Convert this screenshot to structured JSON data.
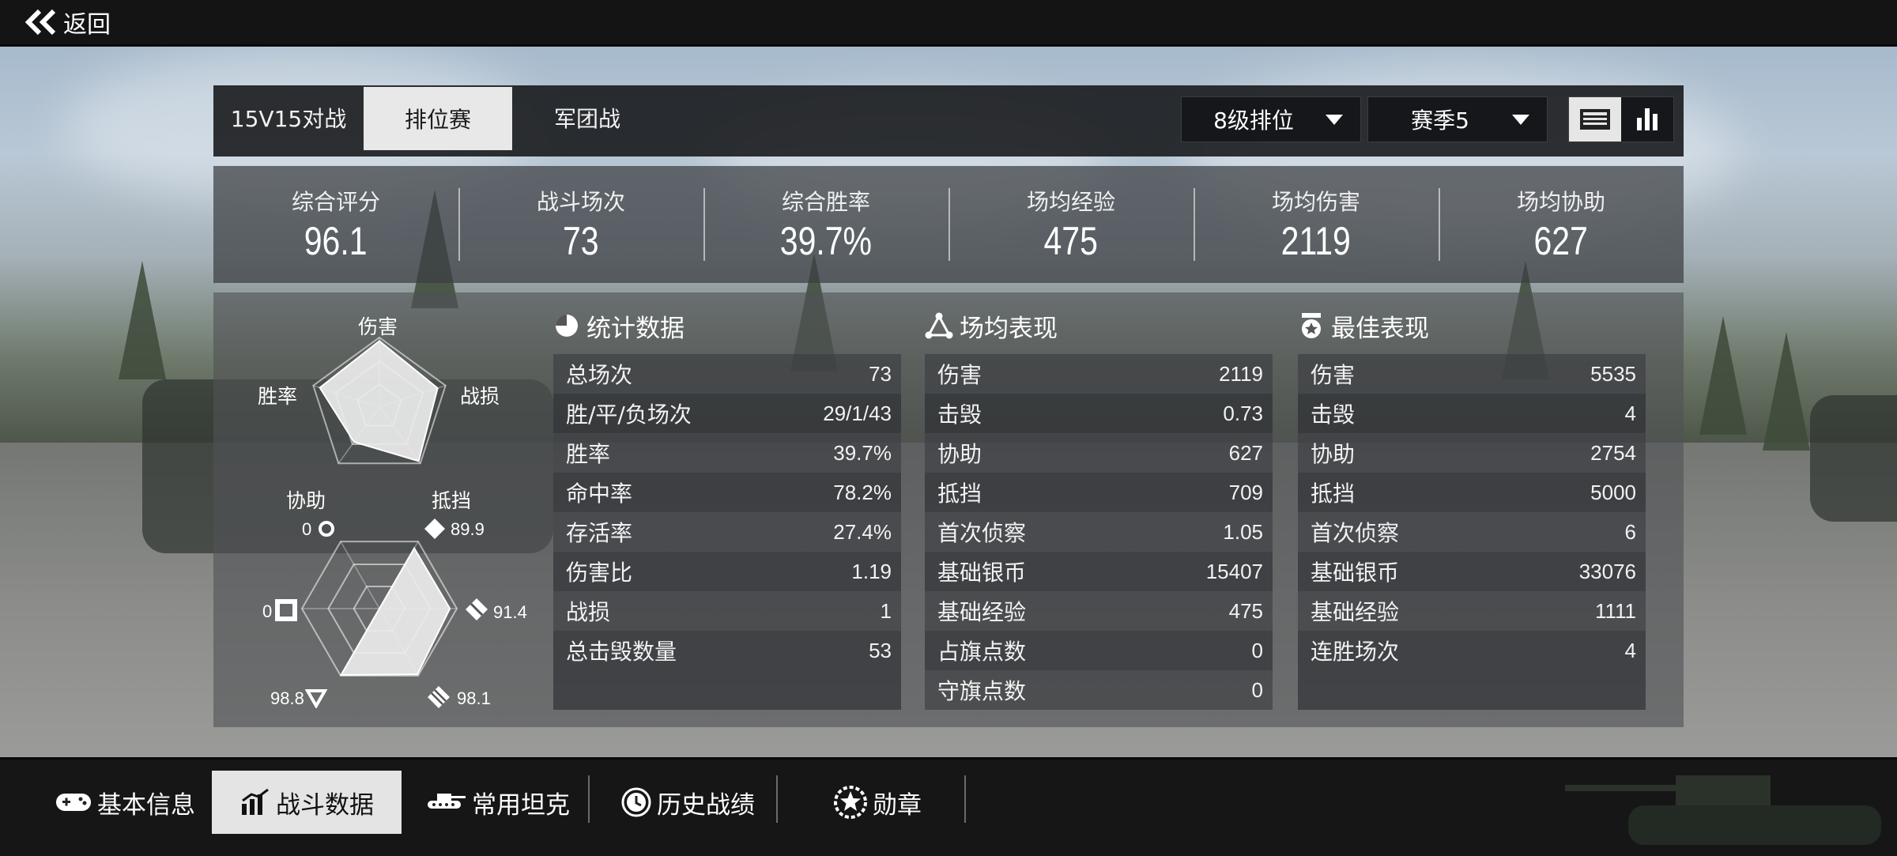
{
  "topbar": {
    "back_label": "返回"
  },
  "mode_tabs": [
    {
      "label": "15V15对战",
      "active": false
    },
    {
      "label": "排位赛",
      "active": true
    },
    {
      "label": "军团战",
      "active": false
    }
  ],
  "filters": {
    "tier": "8级排位",
    "season": "赛季5"
  },
  "view_toggle": {
    "active": "list"
  },
  "summary": [
    {
      "label": "综合评分",
      "value": "96.1"
    },
    {
      "label": "战斗场次",
      "value": "73"
    },
    {
      "label": "综合胜率",
      "value": "39.7%"
    },
    {
      "label": "场均经验",
      "value": "475"
    },
    {
      "label": "场均伤害",
      "value": "2119"
    },
    {
      "label": "场均协助",
      "value": "627"
    }
  ],
  "radar": {
    "labels": {
      "top": "伤害",
      "right": "战损",
      "left": "胜率",
      "bottom_left": "协助",
      "bottom_right": "抵挡"
    },
    "pentagon_levels": [
      0.95,
      0.88,
      0.96,
      0.62,
      0.9
    ],
    "hex_values": {
      "top_left": "0",
      "top_right": "89.9",
      "left": "0",
      "right": "91.4",
      "bottom_left": "98.8",
      "bottom_right": "98.1"
    },
    "hex_levels": [
      0.0,
      0.9,
      0.91,
      0.98,
      0.99,
      0.0
    ]
  },
  "stats": {
    "title": "统计数据",
    "rows": [
      {
        "k": "总场次",
        "v": "73"
      },
      {
        "k": "胜/平/负场次",
        "v": "29/1/43"
      },
      {
        "k": "胜率",
        "v": "39.7%"
      },
      {
        "k": "命中率",
        "v": "78.2%"
      },
      {
        "k": "存活率",
        "v": "27.4%"
      },
      {
        "k": "伤害比",
        "v": "1.19"
      },
      {
        "k": "战损",
        "v": "1"
      },
      {
        "k": "总击毁数量",
        "v": "53"
      }
    ]
  },
  "average": {
    "title": "场均表现",
    "rows": [
      {
        "k": "伤害",
        "v": "2119"
      },
      {
        "k": "击毁",
        "v": "0.73"
      },
      {
        "k": "协助",
        "v": "627"
      },
      {
        "k": "抵挡",
        "v": "709"
      },
      {
        "k": "首次侦察",
        "v": "1.05"
      },
      {
        "k": "基础银币",
        "v": "15407"
      },
      {
        "k": "基础经验",
        "v": "475"
      },
      {
        "k": "占旗点数",
        "v": "0"
      },
      {
        "k": "守旗点数",
        "v": "0"
      }
    ]
  },
  "best": {
    "title": "最佳表现",
    "rows": [
      {
        "k": "伤害",
        "v": "5535"
      },
      {
        "k": "击毁",
        "v": "4"
      },
      {
        "k": "协助",
        "v": "2754"
      },
      {
        "k": "抵挡",
        "v": "5000"
      },
      {
        "k": "首次侦察",
        "v": "6"
      },
      {
        "k": "基础银币",
        "v": "33076"
      },
      {
        "k": "基础经验",
        "v": "1111"
      },
      {
        "k": "连胜场次",
        "v": "4"
      }
    ]
  },
  "bottom_nav": [
    {
      "label": "基本信息",
      "icon": "gamepad-icon",
      "active": false
    },
    {
      "label": "战斗数据",
      "icon": "bar-chart-icon",
      "active": true
    },
    {
      "label": "常用坦克",
      "icon": "tank-icon",
      "active": false
    },
    {
      "label": "历史战绩",
      "icon": "history-clock-icon",
      "active": false
    },
    {
      "label": "勋章",
      "icon": "medal-icon",
      "active": false
    }
  ],
  "colors": {
    "accent": "#e8e8e8",
    "panel": "#15171a"
  }
}
